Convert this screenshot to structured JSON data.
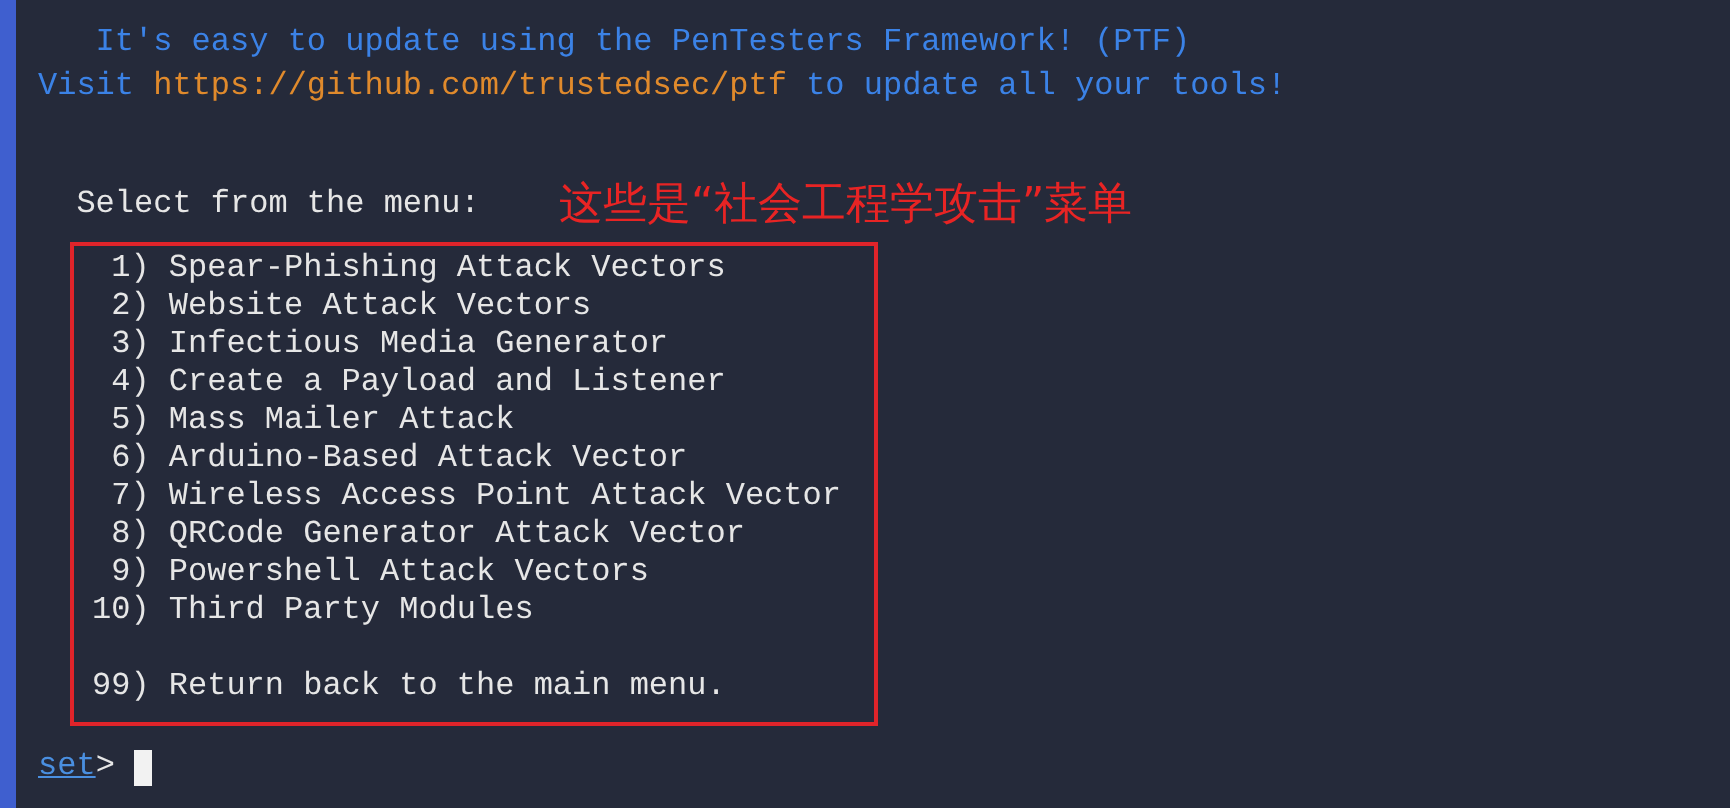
{
  "banner": {
    "line_1": "It's easy to update using the PenTesters Framework! (PTF)",
    "line_2_before": "Visit",
    "link": "https://github.com/trustedsec/ptf",
    "line_2_after": "to update all your tools!"
  },
  "menu": {
    "prompt": "Select from the menu:",
    "annotation": "这些是“社会工程学攻击”菜单",
    "items": [
      {
        "number": "1)",
        "label": "Spear-Phishing Attack Vectors"
      },
      {
        "number": "2)",
        "label": "Website Attack Vectors"
      },
      {
        "number": "3)",
        "label": "Infectious Media Generator"
      },
      {
        "number": "4)",
        "label": "Create a Payload and Listener"
      },
      {
        "number": "5)",
        "label": "Mass Mailer Attack"
      },
      {
        "number": "6)",
        "label": "Arduino-Based Attack Vector"
      },
      {
        "number": "7)",
        "label": "Wireless Access Point Attack Vector"
      },
      {
        "number": "8)",
        "label": "QRCode Generator Attack Vector"
      },
      {
        "number": "9)",
        "label": "Powershell Attack Vectors"
      },
      {
        "number": "10)",
        "label": "Third Party Modules"
      }
    ],
    "exit_item": {
      "number": "99)",
      "label": "Return back to the main menu."
    }
  },
  "shell_prompt": {
    "name": "set",
    "symbol": ">"
  }
}
